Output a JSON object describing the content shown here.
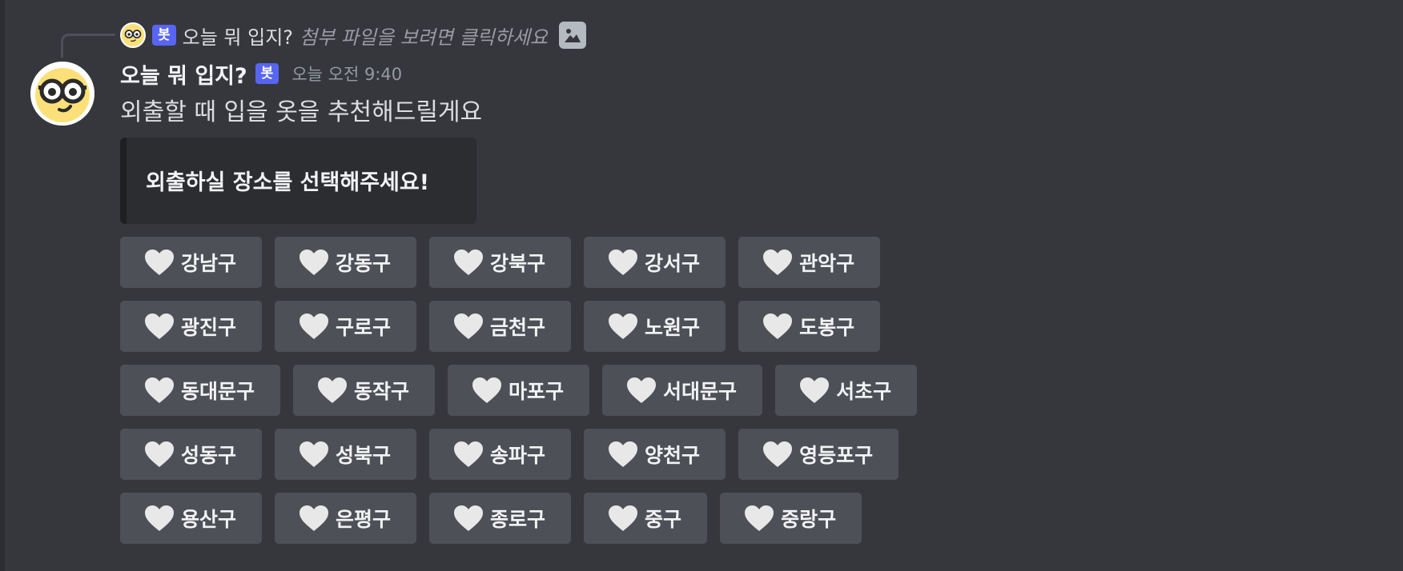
{
  "reply": {
    "bot_tag": "봇",
    "name": "오늘 뭐 입지?",
    "hint": "첨부 파일을 보려면 클릭하세요"
  },
  "message": {
    "username": "오늘 뭐 입지?",
    "bot_tag": "봇",
    "timestamp": "오늘 오전 9:40",
    "text": "외출할 때 입을 옷을 추천해드릴게요",
    "embed_title": "외출하실 장소를 선택해주세요!"
  },
  "buttons": {
    "icon": "heart-icon",
    "rows": [
      [
        "강남구",
        "강동구",
        "강북구",
        "강서구",
        "관악구"
      ],
      [
        "광진구",
        "구로구",
        "금천구",
        "노원구",
        "도봉구"
      ],
      [
        "동대문구",
        "동작구",
        "마포구",
        "서대문구",
        "서초구"
      ],
      [
        "성동구",
        "성북구",
        "송파구",
        "양천구",
        "영등포구"
      ],
      [
        "용산구",
        "은평구",
        "종로구",
        "중구",
        "중랑구"
      ]
    ]
  },
  "colors": {
    "background": "#36373d",
    "button": "#4e5058",
    "bot_tag": "#5865f2",
    "embed": "#2b2d31"
  }
}
